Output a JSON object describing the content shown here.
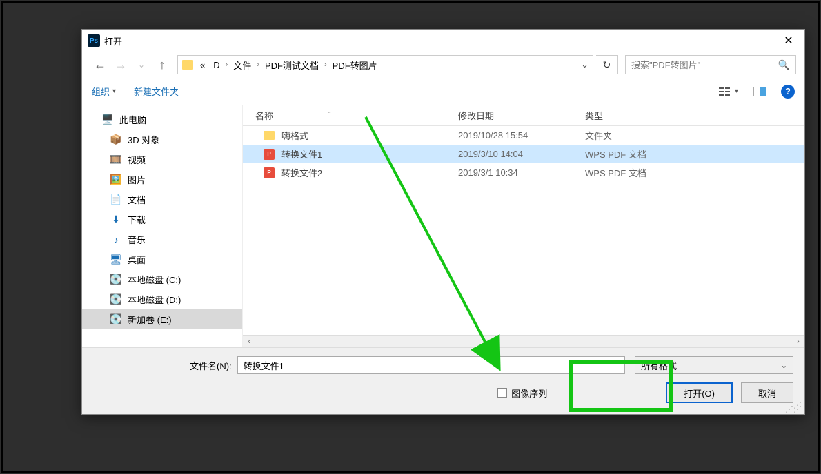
{
  "title": "打开",
  "breadcrumb": {
    "pre": "«",
    "d": "D",
    "wj": "文件",
    "pdftest": "PDF测试文档",
    "pdfimg": "PDF转图片"
  },
  "search": {
    "placeholder": "搜索\"PDF转图片\""
  },
  "toolbar": {
    "organize": "组织",
    "newfolder": "新建文件夹"
  },
  "columns": {
    "name": "名称",
    "date": "修改日期",
    "type": "类型"
  },
  "sidebar": {
    "thispc": "此电脑",
    "items": [
      "3D 对象",
      "视频",
      "图片",
      "文档",
      "下载",
      "音乐",
      "桌面",
      "本地磁盘 (C:)",
      "本地磁盘 (D:)",
      "新加卷 (E:)"
    ]
  },
  "files": [
    {
      "name": "嗨格式",
      "date": "2019/10/28 15:54",
      "type": "文件夹",
      "kind": "folder"
    },
    {
      "name": "转换文件1",
      "date": "2019/3/10 14:04",
      "type": "WPS PDF 文档",
      "kind": "pdf",
      "selected": true
    },
    {
      "name": "转换文件2",
      "date": "2019/3/1 10:34",
      "type": "WPS PDF 文档",
      "kind": "pdf"
    }
  ],
  "footer": {
    "filename_label": "文件名(N):",
    "filename_value": "转换文件1",
    "filetype": "所有格式",
    "sequence": "图像序列",
    "open": "打开(O)",
    "cancel": "取消"
  }
}
